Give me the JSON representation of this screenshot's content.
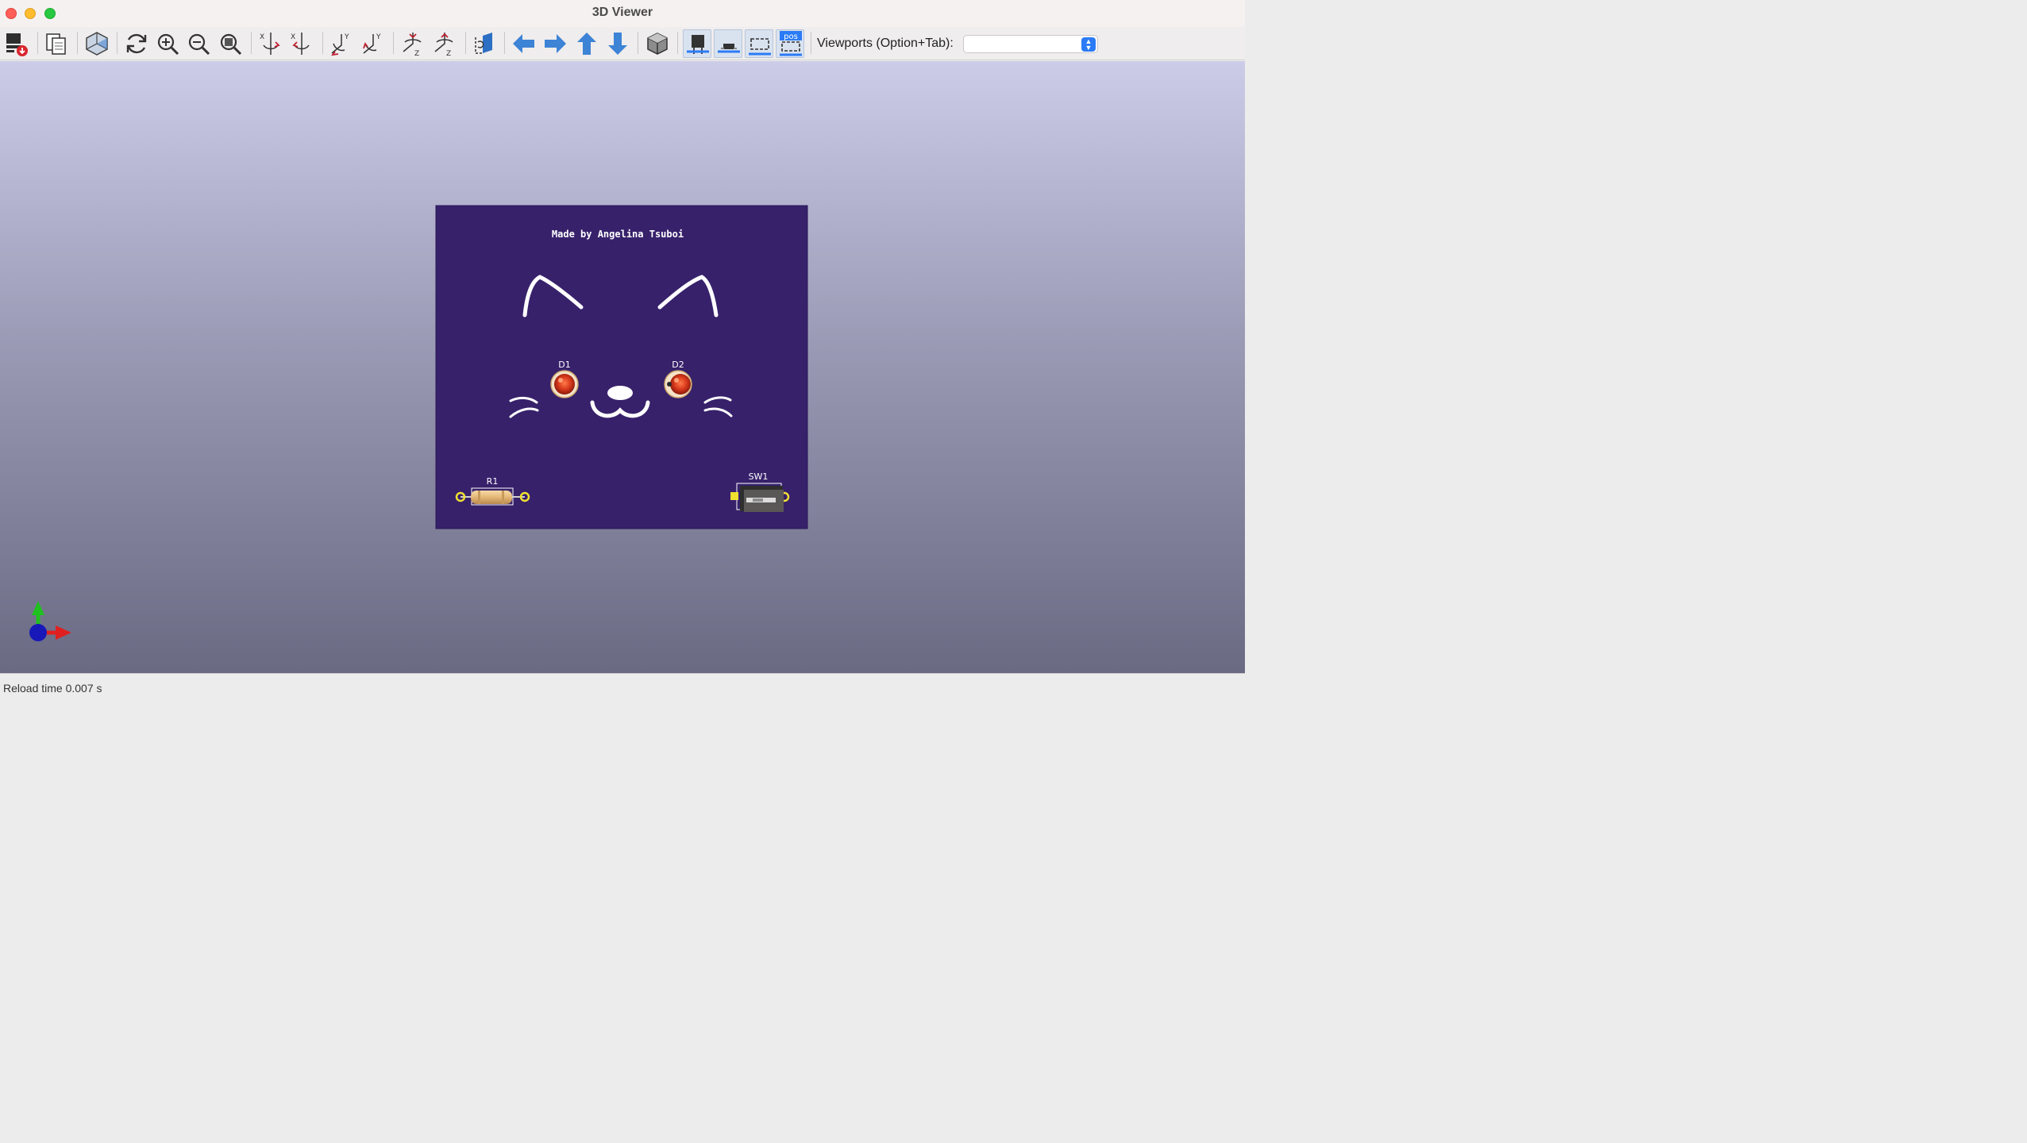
{
  "window": {
    "title": "3D Viewer"
  },
  "toolbar": {
    "buttons": [
      {
        "name": "export-button",
        "icon": "export-icon"
      },
      {
        "name": "copy-button",
        "icon": "copy-icon"
      },
      {
        "name": "raytrace-button",
        "icon": "raytrace-icon"
      },
      {
        "name": "reload-button",
        "icon": "refresh-icon"
      },
      {
        "name": "zoom-in-button",
        "icon": "zoom-in-icon"
      },
      {
        "name": "zoom-out-button",
        "icon": "zoom-out-icon"
      },
      {
        "name": "zoom-fit-button",
        "icon": "zoom-fit-icon"
      },
      {
        "name": "rotate-x-cw-button",
        "icon": "rotate-x-icon"
      },
      {
        "name": "rotate-x-ccw-button",
        "icon": "rotate-x-icon"
      },
      {
        "name": "rotate-y-cw-button",
        "icon": "rotate-y-icon"
      },
      {
        "name": "rotate-y-ccw-button",
        "icon": "rotate-y-icon"
      },
      {
        "name": "rotate-z-cw-button",
        "icon": "rotate-z-icon"
      },
      {
        "name": "rotate-z-ccw-button",
        "icon": "rotate-z-icon"
      },
      {
        "name": "flip-board-button",
        "icon": "flip-icon"
      },
      {
        "name": "move-left-button",
        "icon": "arrow-left-icon"
      },
      {
        "name": "move-right-button",
        "icon": "arrow-right-icon"
      },
      {
        "name": "move-up-button",
        "icon": "arrow-up-icon"
      },
      {
        "name": "move-down-button",
        "icon": "arrow-down-icon"
      },
      {
        "name": "orthographic-button",
        "icon": "cube-icon"
      },
      {
        "name": "show-tht-button",
        "icon": "tht-icon"
      },
      {
        "name": "show-smd-button",
        "icon": "smd-icon"
      },
      {
        "name": "show-virtual-button",
        "icon": "virtual-icon"
      },
      {
        "name": "show-not-in-pos-button",
        "icon": "pos-icon"
      }
    ],
    "pos_badge": "pos",
    "viewports_label": "Viewports (Option+Tab):",
    "viewports_value": "",
    "colors": {
      "accent": "#2b7bf6",
      "arrow": "#3d83d6"
    }
  },
  "viewer": {
    "board": {
      "color": "#37216b",
      "silk_text": "Made by Angelina Tsuboi",
      "refs": {
        "d1": "D1",
        "d2": "D2",
        "r1": "R1",
        "sw1": "SW1"
      }
    },
    "axes": {
      "x_color": "#e02020",
      "y_color": "#20c020",
      "z_color": "#1818b8"
    }
  },
  "status": {
    "text": "Reload time 0.007 s"
  }
}
